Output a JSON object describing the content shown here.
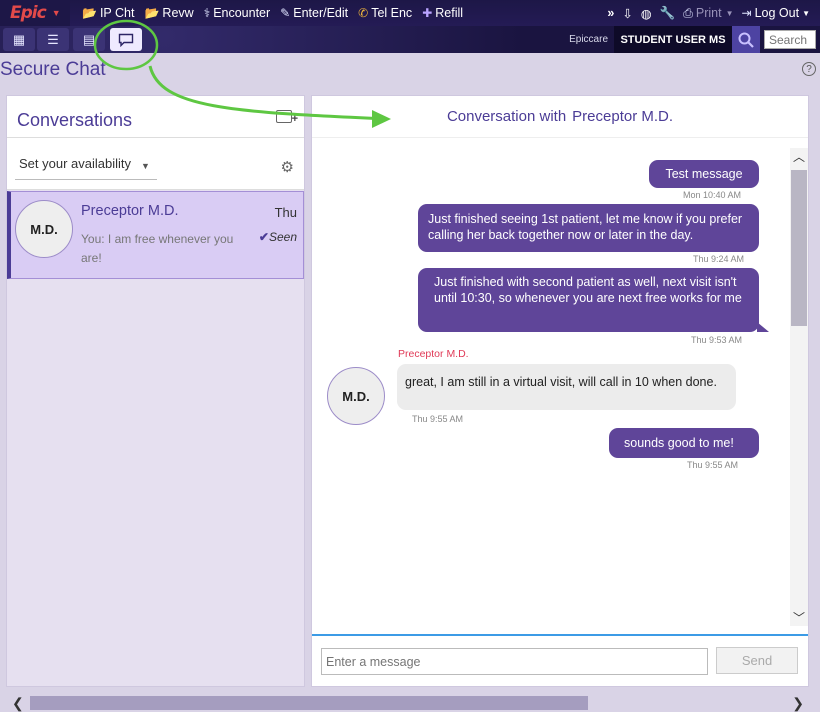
{
  "toolbar": {
    "epic_label": "Epic",
    "items": [
      {
        "icon": "chart-icon",
        "label": "IP Cht"
      },
      {
        "icon": "review-icon",
        "label": "Revw"
      },
      {
        "icon": "encounter-icon",
        "label": "Encounter"
      },
      {
        "icon": "pencil-icon",
        "label": "Enter/Edit"
      },
      {
        "icon": "phone-icon",
        "label": "Tel Enc"
      },
      {
        "icon": "refill-icon",
        "label": "Refill"
      }
    ],
    "more": "»",
    "print_label": "Print",
    "logout_label": "Log Out"
  },
  "activity_tabs": [
    {
      "icon": "calendar-icon",
      "glyph": "▦"
    },
    {
      "icon": "patient-list-icon",
      "glyph": "☰"
    },
    {
      "icon": "reports-icon",
      "glyph": "▤"
    },
    {
      "icon": "chat-icon",
      "glyph": "💬",
      "active": true
    }
  ],
  "header": {
    "app_name": "Epiccare",
    "user": "STUDENT USER MS",
    "search_placeholder": "Search"
  },
  "page": {
    "title": "Secure Chat",
    "help": "?"
  },
  "conversations": {
    "title": "Conversations",
    "availability": "Set your availability",
    "items": [
      {
        "initials": "M.D.",
        "name": "Preceptor M.D.",
        "time": "Thu",
        "preview": "You: I am free whenever you are!",
        "status": "Seen"
      }
    ]
  },
  "chat": {
    "header_prefix": "Conversation with",
    "participant": "Preceptor M.D.",
    "messages": [
      {
        "from": "me",
        "text": "Test message",
        "time": "Mon 10:40 AM"
      },
      {
        "from": "me",
        "text": "Just finished seeing 1st patient, let me know if you prefer calling her back together now or later in the day.",
        "time": "Thu 9:24 AM"
      },
      {
        "from": "me",
        "text": "Just finished with second patient as well, next visit isn't until 10:30, so whenever you are next free works for me",
        "time": "Thu 9:53 AM"
      },
      {
        "from": "Preceptor M.D.",
        "initials": "M.D.",
        "text": "great, I am still in a virtual visit, will call in 10 when done.",
        "time": "Thu 9:55 AM"
      },
      {
        "from": "me",
        "text": "sounds good to me!",
        "time": "Thu 9:55 AM"
      }
    ],
    "input_placeholder": "Enter a message",
    "send_label": "Send"
  },
  "colors": {
    "accent": "#4b3c96",
    "bubble": "#5f4599",
    "sender_name": "#e03a57",
    "annotation": "#5ec742"
  }
}
